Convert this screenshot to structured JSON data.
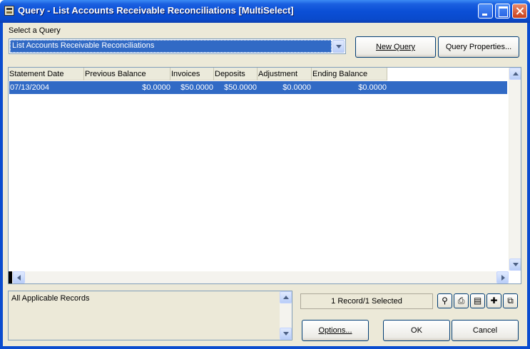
{
  "window": {
    "title": "Query - List Accounts Receivable Reconciliations  [MultiSelect]"
  },
  "query": {
    "select_label": "Select a Query",
    "selected_value": "List Accounts Receivable Reconciliations",
    "new_query_label": "New Query",
    "query_properties_label": "Query Properties..."
  },
  "table": {
    "columns": [
      "Statement Date",
      "Previous Balance",
      "Invoices",
      "Deposits",
      "Adjustment",
      "Ending Balance"
    ],
    "rows": [
      {
        "statement_date": "07/13/2004",
        "previous_balance": "$0.0000",
        "invoices": "$50.0000",
        "deposits": "$50.0000",
        "adjustment": "$0.0000",
        "ending_balance": "$0.0000",
        "selected": true
      }
    ]
  },
  "filter": {
    "text": "All Applicable Records"
  },
  "status": {
    "text": "1 Record/1 Selected"
  },
  "toolbar": {
    "icons": [
      "find-icon",
      "print-icon",
      "print-preview-icon",
      "select-icon",
      "copy-icon"
    ]
  },
  "buttons": {
    "options_label": "Options...",
    "ok_label": "OK",
    "cancel_label": "Cancel"
  },
  "colors": {
    "titlebar": "#0a4ccf",
    "selection": "#316ac5",
    "dialog_bg": "#ece9d8"
  }
}
